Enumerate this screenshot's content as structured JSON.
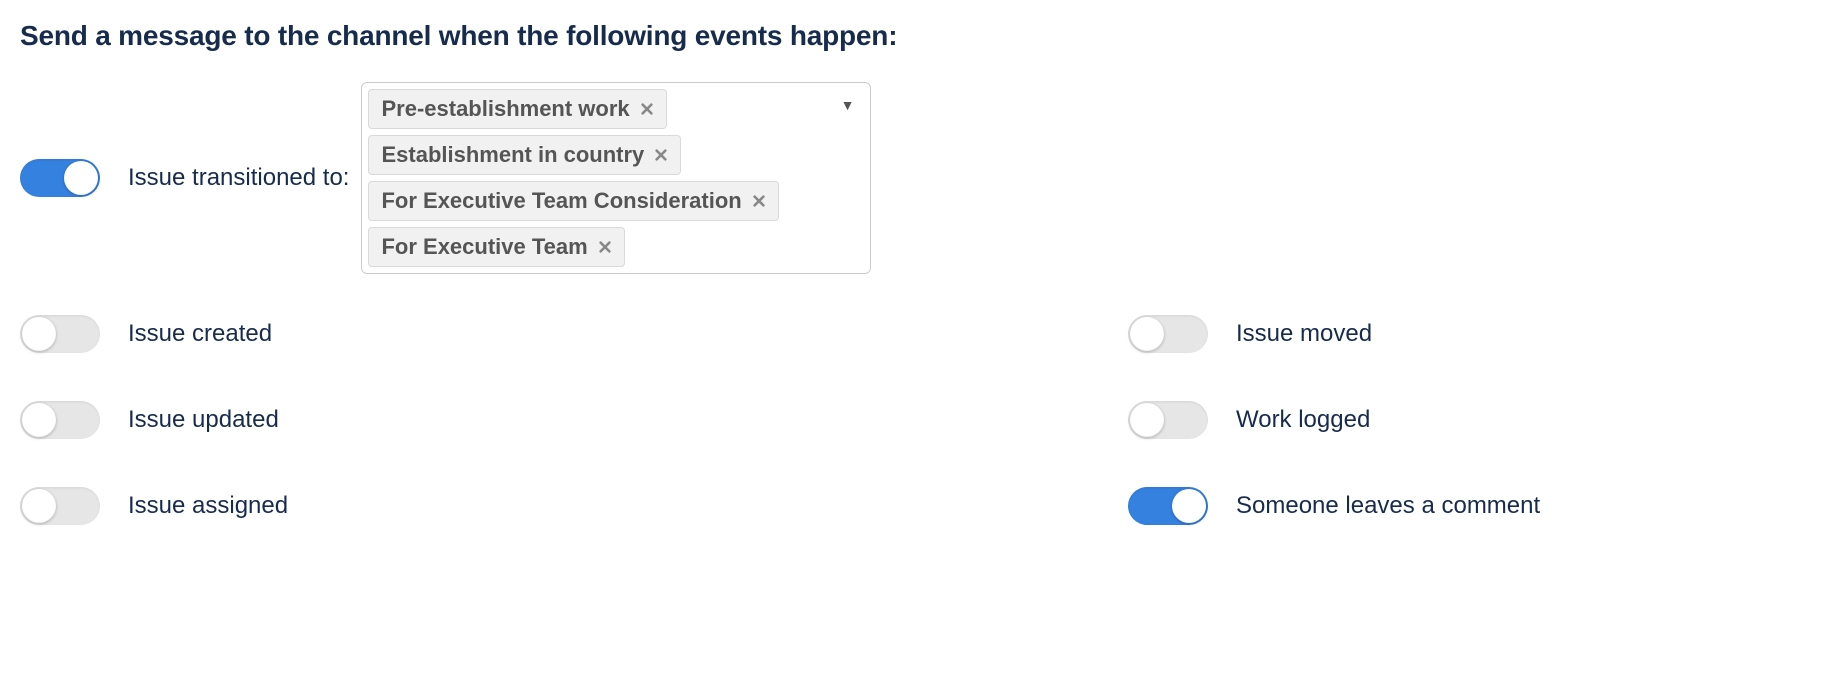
{
  "heading": "Send a message to the channel when the following events happen:",
  "transition": {
    "label": "Issue transitioned to:",
    "on": true,
    "tags": [
      "Pre-establishment work",
      "Establishment in country",
      "For Executive Team Consideration",
      "For Executive Team"
    ]
  },
  "left": [
    {
      "label": "Issue created",
      "on": false
    },
    {
      "label": "Issue updated",
      "on": false
    },
    {
      "label": "Issue assigned",
      "on": false
    }
  ],
  "right": [
    {
      "label": "Issue moved",
      "on": false
    },
    {
      "label": "Work logged",
      "on": false
    },
    {
      "label": "Someone leaves a comment",
      "on": true
    }
  ]
}
